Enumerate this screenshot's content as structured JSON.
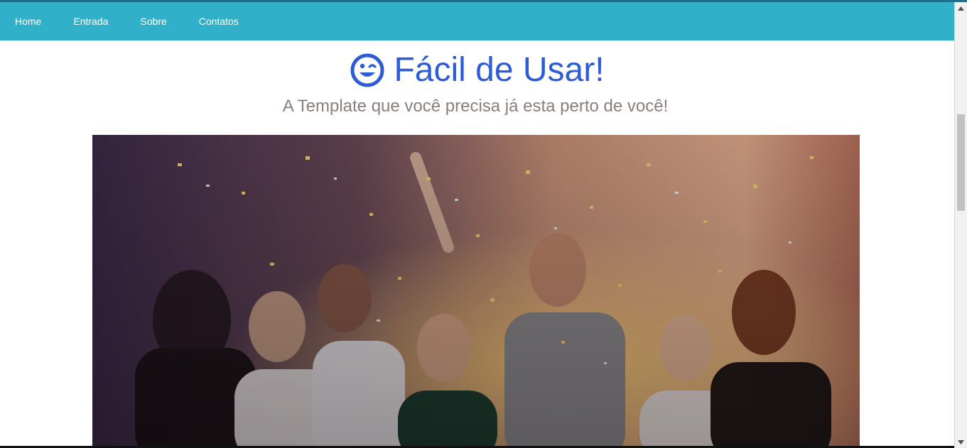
{
  "nav": {
    "items": [
      "Home",
      "Entrada",
      "Sobre",
      "Contatos"
    ]
  },
  "hero": {
    "title": "Fácil de Usar!",
    "subtitle": "A Template que você precisa já esta perto de você!",
    "title_icon": "smiley-wink-icon",
    "image": "party-confetti-photo"
  },
  "colors": {
    "navbar": "#31b0c9",
    "title": "#2e5bd6",
    "subtitle": "#8a7f7a"
  }
}
